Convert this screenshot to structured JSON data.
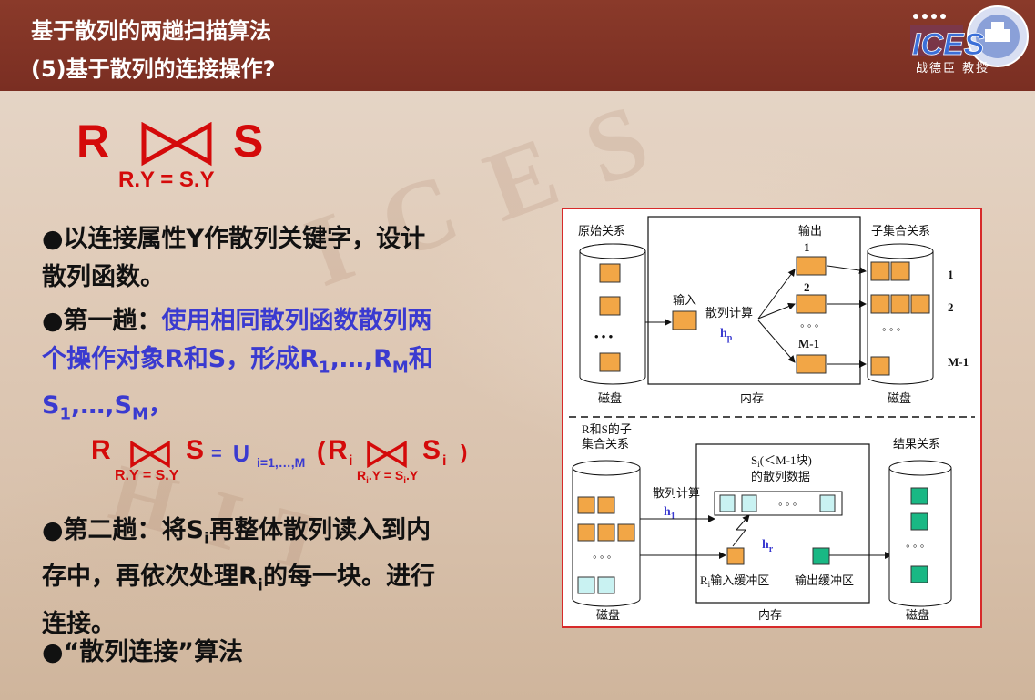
{
  "header": {
    "title_line1": "基于散列的两趟扫描算法",
    "title_line2": "(5)基于散列的连接操作?",
    "logo_text": "ICES",
    "logo_caption": "战德臣 教授"
  },
  "formula_main": {
    "left": "R",
    "right": "S",
    "condition": "R.Y = S.Y"
  },
  "bullets": {
    "b1_line1": "●以连接属性Y作散列关键字，设计",
    "b1_line2": "散列函数。",
    "b2_prefix": "●第一趟：",
    "b2_blue1": "使用相同散列函数散列两",
    "b2_line2_a": "个操作对象R和S，形成R",
    "b2_sub1": "1",
    "b2_line2_b": ",…,R",
    "b2_subM": "M",
    "b2_line2_c": "和",
    "b2_line3_a": "S",
    "b2_line3_sub1": "1",
    "b2_line3_b": ",…,S",
    "b2_line3_subM": "M",
    "b2_line3_c": "，",
    "b3_line1_a": "●第二趟：将S",
    "b3_line1_sub": "i",
    "b3_line1_b": "再整体散列读入到内",
    "b3_line2_a": "存中，再依次处理R",
    "b3_line2_sub": "i",
    "b3_line2_b": "的每一块。进行",
    "b3_line3": "连接。",
    "b4": "●“散列连接”算法"
  },
  "formula_union": {
    "R": "R",
    "S": "S",
    "cond": "R.Y = S.Y",
    "equals": "=",
    "union": "∪",
    "union_sub": "i=1,…,M",
    "Ri": "R",
    "Ri_sub": "i",
    "Si": "S",
    "Si_sub": "i",
    "cond2": "R",
    "cond2_b": ".Y = S",
    "cond2_c": ".Y",
    "open": "(",
    "close": ")"
  },
  "diagram": {
    "top": {
      "orig_rel": "原始关系",
      "disk1": "磁盘",
      "memory": "内存",
      "disk2": "磁盘",
      "input": "输入",
      "hash_calc": "散列计算",
      "hp": "h",
      "hp_sub": "p",
      "output": "输出",
      "subset_rel": "子集合关系",
      "b1": "1",
      "b2": "2",
      "bm1": "M-1",
      "r1": "1",
      "r2": "2",
      "rm1": "M-1",
      "dots": "• • •",
      "dots2": "◦ ◦ ◦"
    },
    "bottom": {
      "rs_subset_1": "R和S的子",
      "rs_subset_2": "集合关系",
      "si_label": "S",
      "si_sub": "i",
      "si_rest": "(＜M-1块)",
      "si_line2": "的散列数据",
      "result_rel": "结果关系",
      "hash_calc": "散列计算",
      "h1": "h",
      "h1_sub": "1",
      "hr": "h",
      "hr_sub": "r",
      "ri_input": "R",
      "ri_input_sub": "i",
      "ri_input_rest": "输入缓冲区",
      "output_buf": "输出缓冲区",
      "disk1": "磁盘",
      "memory": "内存",
      "disk2": "磁盘",
      "dots": "◦ ◦ ◦"
    },
    "colors": {
      "orange": "#f2a646",
      "cyan": "#c9f2f2",
      "green": "#19b884",
      "border": "#d72a2a"
    }
  }
}
